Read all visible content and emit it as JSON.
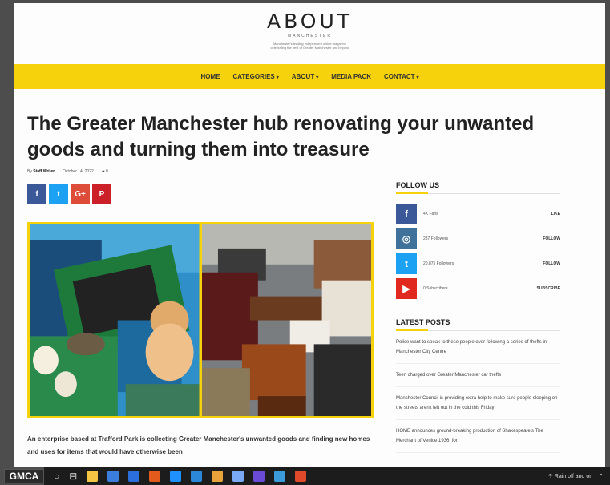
{
  "site": {
    "logo": "ABOUT",
    "logo_sub": "MANCHESTER",
    "tagline_line1": "Manchester's leading independent online magazine",
    "tagline_line2": "celebrating the best of Greater Manchester and beyond"
  },
  "nav": {
    "items": [
      "HOME",
      "CATEGORIES",
      "ABOUT",
      "MEDIA PACK",
      "CONTACT"
    ],
    "dropdowns": [
      false,
      true,
      true,
      false,
      true
    ]
  },
  "article": {
    "title": "The Greater Manchester hub renovating your unwanted goods and turning them into treasure",
    "author_prefix": "By",
    "author": "Staff Writer",
    "date": "October 14, 2022",
    "comments": "0",
    "intro": "An enterprise based at Trafford Park is collecting Greater Manchester's unwanted goods and finding new homes and uses for items that would have otherwise been"
  },
  "share": [
    {
      "label": "f",
      "color": "#3b5998",
      "name": "facebook"
    },
    {
      "label": "t",
      "color": "#1da1f2",
      "name": "twitter"
    },
    {
      "label": "G+",
      "color": "#dd4b39",
      "name": "google-plus"
    },
    {
      "label": "P",
      "color": "#cb2027",
      "name": "pinterest"
    }
  ],
  "sidebar": {
    "follow_heading": "FOLLOW US",
    "follow": [
      {
        "icon": "f",
        "color": "#3b5998",
        "count": "4K Fans",
        "action": "LIKE"
      },
      {
        "icon": "◎",
        "color": "#3f729b",
        "count": "237 Followers",
        "action": "FOLLOW"
      },
      {
        "icon": "t",
        "color": "#1da1f2",
        "count": "20,875 Followers",
        "action": "FOLLOW"
      },
      {
        "icon": "▶",
        "color": "#e02a20",
        "count": "0 Subscribers",
        "action": "SUBSCRIBE"
      }
    ],
    "latest_heading": "LATEST POSTS",
    "posts": [
      "Police want to speak to these people over following a series of thefts in Manchester City Centre",
      "Teen charged over Greater Manchester car thefts",
      "Manchester Council is providing extra help to make sure people sleeping on the streets aren't left out in the cold this Friday",
      "HOME announces ground-breaking production of Shakespeare's The Merchant of Venice 1936, for"
    ]
  },
  "taskbar": {
    "start_label": "GMCA",
    "tray_text": "Rain off and on",
    "search_glyph": "○",
    "task_view_glyph": "⊟"
  },
  "colors": {
    "accent": "#f6d20c",
    "page_bg": "#fdfdfd",
    "frame_bg": "#4d4d4d"
  }
}
